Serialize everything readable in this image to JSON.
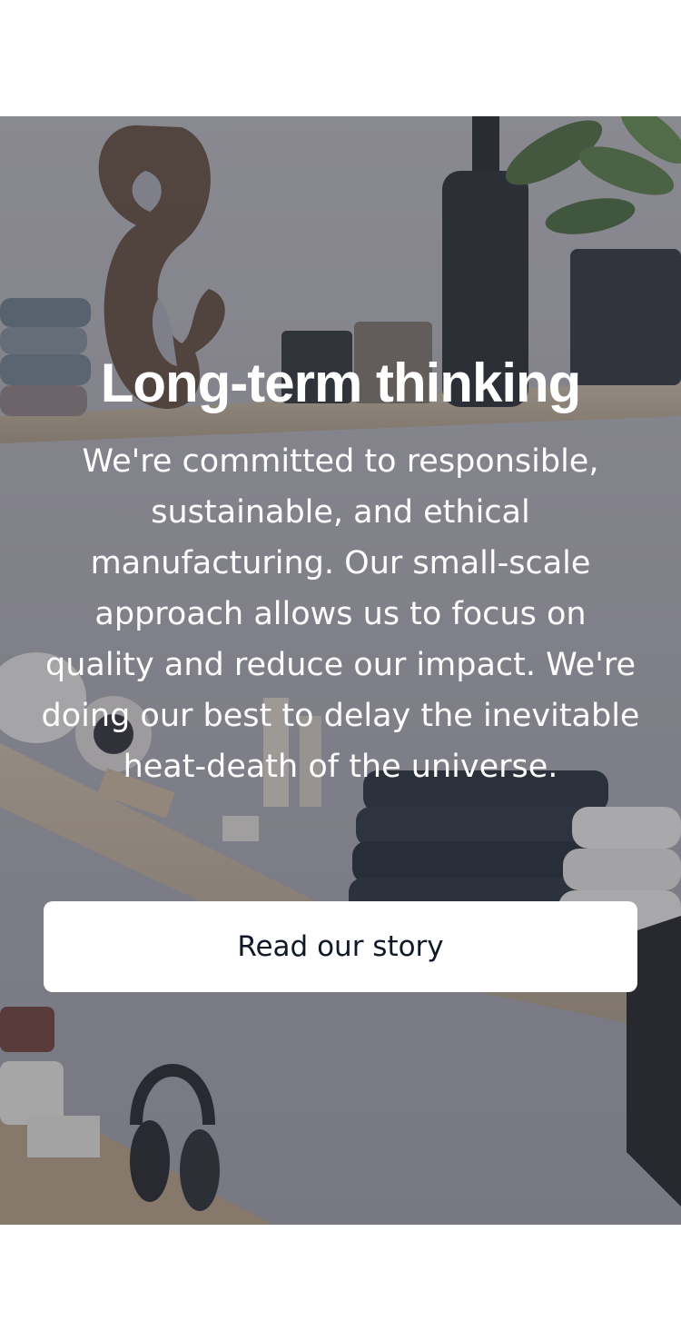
{
  "hero": {
    "title": "Long-term thinking",
    "description": "We're committed to responsible, sustainable, and ethical manufacturing. Our small-scale approach allows us to focus on quality and reduce our impact. We're doing our best to delay the inevitable heat-death of the universe.",
    "cta_label": "Read our story"
  }
}
